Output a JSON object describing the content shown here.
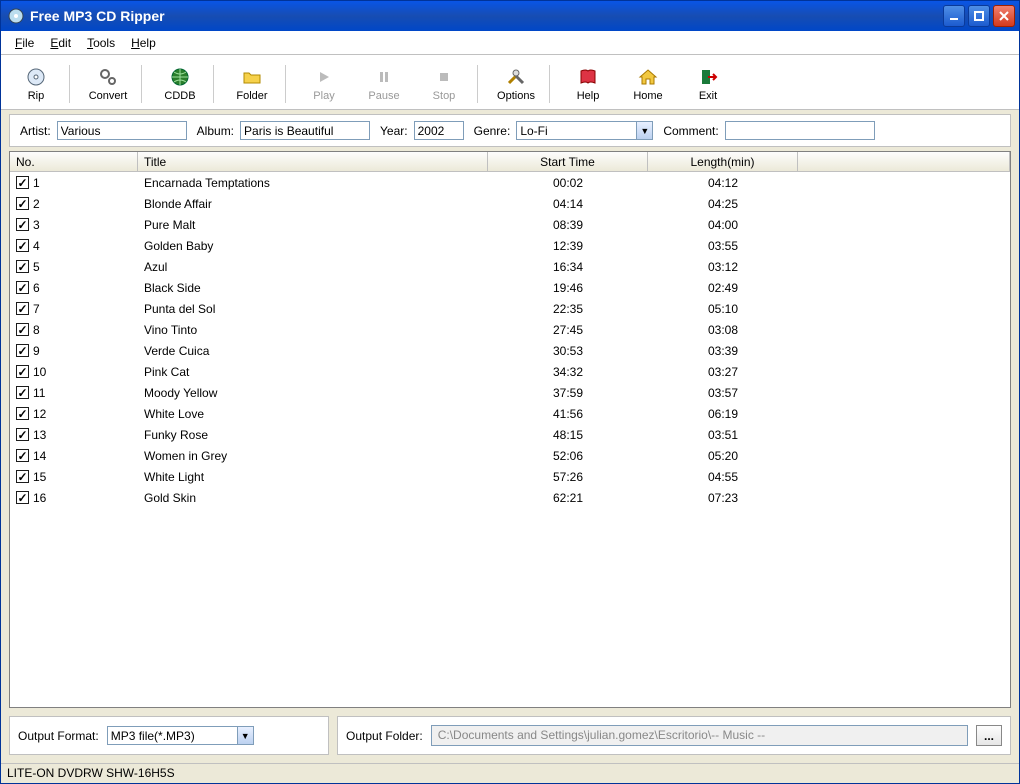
{
  "window": {
    "title": "Free MP3 CD Ripper"
  },
  "menu": {
    "file": "File",
    "edit": "Edit",
    "tools": "Tools",
    "help": "Help"
  },
  "toolbar": {
    "rip": "Rip",
    "convert": "Convert",
    "cddb": "CDDB",
    "folder": "Folder",
    "play": "Play",
    "pause": "Pause",
    "stop": "Stop",
    "options": "Options",
    "help": "Help",
    "home": "Home",
    "exit": "Exit"
  },
  "meta": {
    "artist_label": "Artist:",
    "artist": "Various",
    "album_label": "Album:",
    "album": "Paris is Beautiful",
    "year_label": "Year:",
    "year": "2002",
    "genre_label": "Genre:",
    "genre": "Lo-Fi",
    "comment_label": "Comment:",
    "comment": ""
  },
  "columns": {
    "no": "No.",
    "title": "Title",
    "start": "Start Time",
    "length": "Length(min)"
  },
  "tracks": [
    {
      "no": "1",
      "title": "Encarnada Temptations",
      "start": "00:02",
      "len": "04:12"
    },
    {
      "no": "2",
      "title": "Blonde Affair",
      "start": "04:14",
      "len": "04:25"
    },
    {
      "no": "3",
      "title": "Pure Malt",
      "start": "08:39",
      "len": "04:00"
    },
    {
      "no": "4",
      "title": "Golden Baby",
      "start": "12:39",
      "len": "03:55"
    },
    {
      "no": "5",
      "title": "Azul",
      "start": "16:34",
      "len": "03:12"
    },
    {
      "no": "6",
      "title": "Black Side",
      "start": "19:46",
      "len": "02:49"
    },
    {
      "no": "7",
      "title": "Punta del Sol",
      "start": "22:35",
      "len": "05:10"
    },
    {
      "no": "8",
      "title": "Vino Tinto",
      "start": "27:45",
      "len": "03:08"
    },
    {
      "no": "9",
      "title": "Verde Cuica",
      "start": "30:53",
      "len": "03:39"
    },
    {
      "no": "10",
      "title": "Pink Cat",
      "start": "34:32",
      "len": "03:27"
    },
    {
      "no": "11",
      "title": "Moody Yellow",
      "start": "37:59",
      "len": "03:57"
    },
    {
      "no": "12",
      "title": "White Love",
      "start": "41:56",
      "len": "06:19"
    },
    {
      "no": "13",
      "title": "Funky Rose",
      "start": "48:15",
      "len": "03:51"
    },
    {
      "no": "14",
      "title": "Women in Grey",
      "start": "52:06",
      "len": "05:20"
    },
    {
      "no": "15",
      "title": "White Light",
      "start": "57:26",
      "len": "04:55"
    },
    {
      "no": "16",
      "title": "Gold Skin",
      "start": "62:21",
      "len": "07:23"
    }
  ],
  "output": {
    "format_label": "Output Format:",
    "format": "MP3 file(*.MP3)",
    "folder_label": "Output Folder:",
    "folder": "C:\\Documents and Settings\\julian.gomez\\Escritorio\\-- Music --"
  },
  "status": "LITE-ON DVDRW SHW-16H5S"
}
